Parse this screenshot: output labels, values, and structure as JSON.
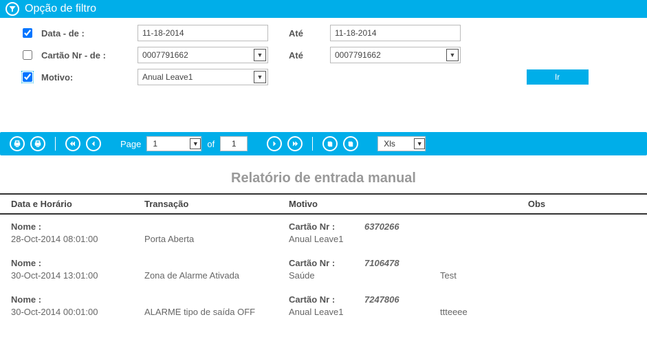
{
  "filter": {
    "title": "Opção de filtro",
    "date_from_label": "Data - de :",
    "date_to_label": "Até",
    "date_from": "11-18-2014",
    "date_to": "11-18-2014",
    "card_from_label": "Cartão Nr - de :",
    "card_to_label": "Até",
    "card_from": "0007791662",
    "card_to": "0007791662",
    "reason_label": "Motivo:",
    "reason_value": "Anual Leave1",
    "go_label": "Ir",
    "chk_date": true,
    "chk_card": false,
    "chk_reason": true
  },
  "toolbar": {
    "page_label": "Page",
    "page_current": "1",
    "of_label": "of",
    "page_total": "1",
    "export_format": "Xls"
  },
  "report": {
    "title": "Relatório de entrada manual",
    "col_date": "Data e Horário",
    "col_trans": "Transação",
    "col_reason": "Motivo",
    "col_obs": "Obs",
    "name_label": "Nome :",
    "card_label": "Cartão Nr :",
    "rows": [
      {
        "card": "6370266",
        "datetime": "28-Oct-2014 08:01:00",
        "trans": "Porta Aberta",
        "reason": "Anual Leave1",
        "obs": ""
      },
      {
        "card": "7106478",
        "datetime": "30-Oct-2014 13:01:00",
        "trans": "Zona de Alarme Ativada",
        "reason": "Saúde",
        "obs": "Test"
      },
      {
        "card": "7247806",
        "datetime": "30-Oct-2014 00:01:00",
        "trans": "ALARME tipo de saída OFF",
        "reason": "Anual Leave1",
        "obs": "ttteeee"
      }
    ]
  }
}
